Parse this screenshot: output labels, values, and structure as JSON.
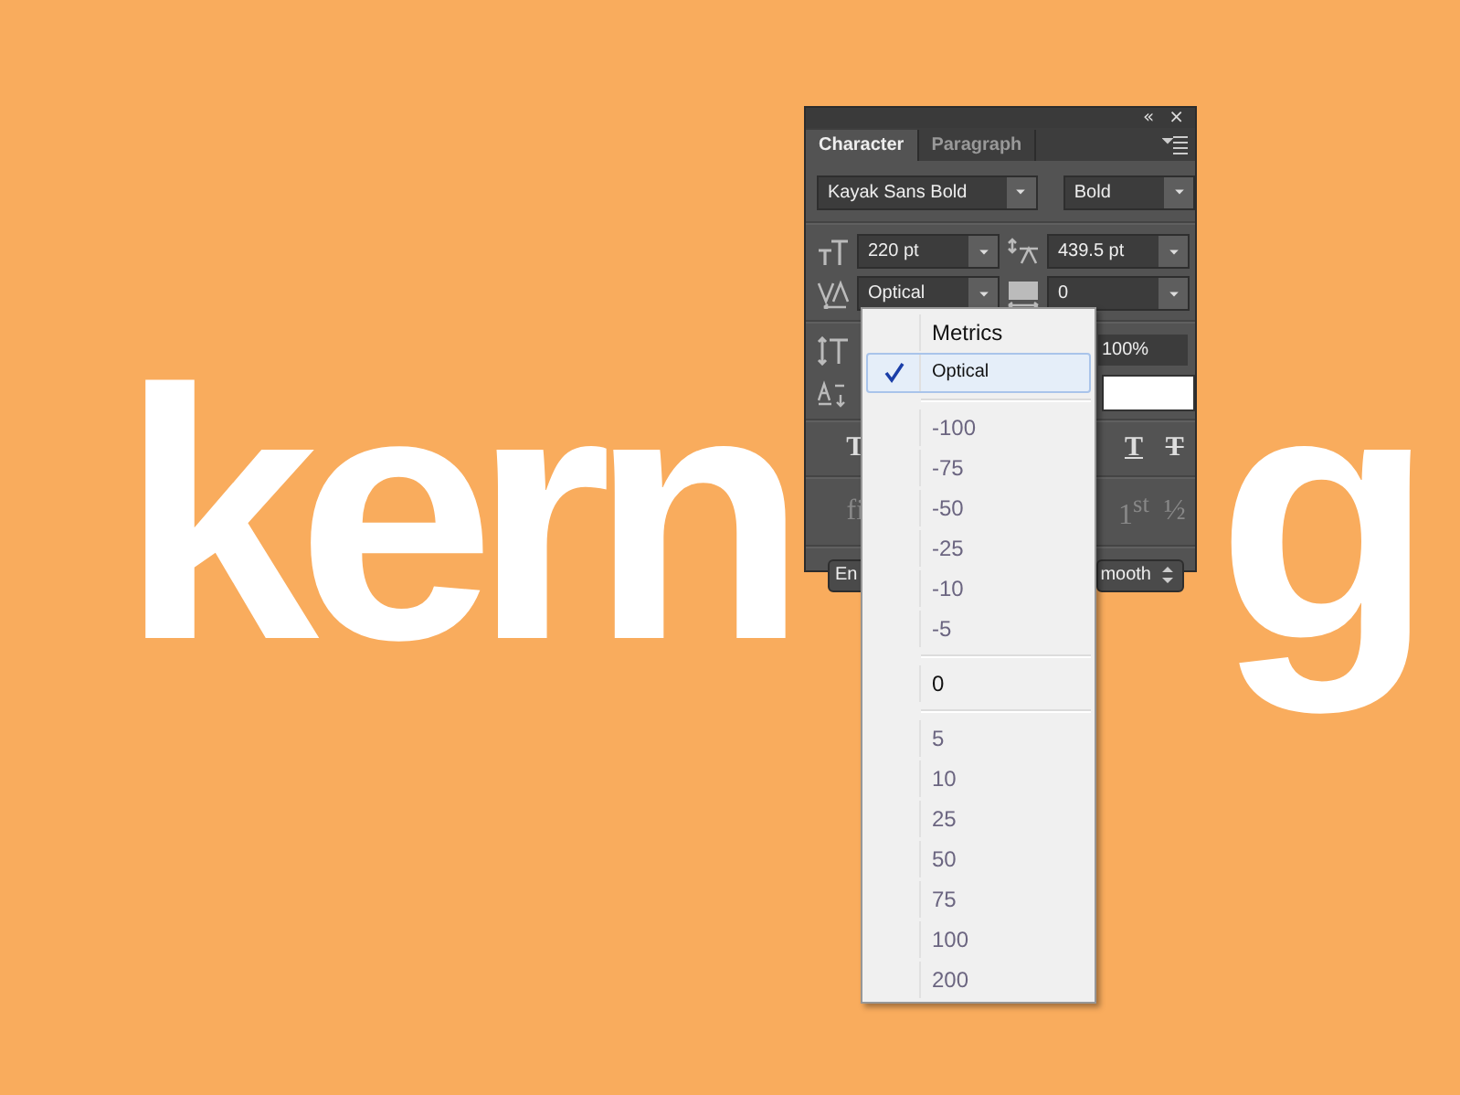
{
  "artwork": {
    "text_left": "kern",
    "text_right": "g"
  },
  "panel": {
    "controls": [
      "«",
      "×"
    ],
    "tabs": [
      {
        "label": "Character",
        "selected": true
      },
      {
        "label": "Paragraph",
        "selected": false
      }
    ],
    "font_family": "Kayak Sans Bold",
    "font_style": "Bold",
    "font_size": "220 pt",
    "leading": "439.5 pt",
    "kerning": "Optical",
    "tracking": "0",
    "horizontal_scale": "100%",
    "style_buttons": [
      {
        "label": "T",
        "kind": "plain"
      },
      {
        "label": "T",
        "kind": "underline"
      },
      {
        "label": "T",
        "kind": "strike"
      }
    ],
    "opentype_buttons": [
      "fi",
      "1$^{st}$",
      "½"
    ],
    "language": "En",
    "antialias": "mooth"
  },
  "menu": {
    "groups": [
      [
        {
          "label": "Metrics",
          "kind": "option",
          "checked": false,
          "selected": false
        },
        {
          "label": "Optical",
          "kind": "option",
          "checked": true,
          "selected": true
        }
      ],
      [
        {
          "label": "-100",
          "kind": "preset",
          "checked": false,
          "selected": false
        },
        {
          "label": "-75",
          "kind": "preset",
          "checked": false,
          "selected": false
        },
        {
          "label": "-50",
          "kind": "preset",
          "checked": false,
          "selected": false
        },
        {
          "label": "-25",
          "kind": "preset",
          "checked": false,
          "selected": false
        },
        {
          "label": "-10",
          "kind": "preset",
          "checked": false,
          "selected": false
        },
        {
          "label": "-5",
          "kind": "preset",
          "checked": false,
          "selected": false
        }
      ],
      [
        {
          "label": "0",
          "kind": "option",
          "checked": false,
          "selected": false
        }
      ],
      [
        {
          "label": "5",
          "kind": "preset",
          "checked": false,
          "selected": false
        },
        {
          "label": "10",
          "kind": "preset",
          "checked": false,
          "selected": false
        },
        {
          "label": "25",
          "kind": "preset",
          "checked": false,
          "selected": false
        },
        {
          "label": "50",
          "kind": "preset",
          "checked": false,
          "selected": false
        },
        {
          "label": "75",
          "kind": "preset",
          "checked": false,
          "selected": false
        },
        {
          "label": "100",
          "kind": "preset",
          "checked": false,
          "selected": false
        },
        {
          "label": "200",
          "kind": "preset",
          "checked": false,
          "selected": false
        }
      ]
    ]
  }
}
